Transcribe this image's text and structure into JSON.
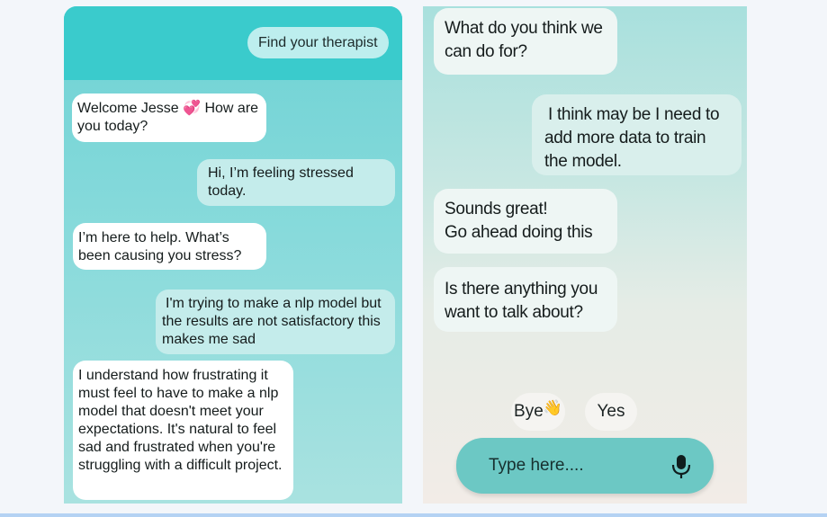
{
  "left_chat": {
    "header_button": "Find your therapist",
    "messages": [
      {
        "sender": "bot",
        "text_before_emoji": "Welcome Jesse",
        "emoji": "💞",
        "text_after_emoji": " How are you today?"
      },
      {
        "sender": "user",
        "text": "Hi, I’m feeling stressed today."
      },
      {
        "sender": "bot",
        "text": "I’m here to help. What’s been causing you stress?"
      },
      {
        "sender": "user",
        "text": "I'm trying to make a nlp model but the results are not satisfactory this makes me sad"
      },
      {
        "sender": "bot",
        "text": "I understand how frustrating it must feel to have to make a nlp model that doesn't meet your expectations. It's natural to feel sad and frustrated when you're struggling with a difficult project."
      }
    ]
  },
  "right_chat": {
    "messages": [
      {
        "sender": "bot",
        "text": "What do you think we can do for?"
      },
      {
        "sender": "user",
        "text": "I think may be I need to add more data to train the model."
      },
      {
        "sender": "bot",
        "line1": "Sounds great!",
        "line2": "Go ahead doing this"
      },
      {
        "sender": "bot",
        "text": "Is there anything you want to talk about?"
      }
    ],
    "quick_replies": [
      {
        "label": "Bye",
        "emoji": "👋"
      },
      {
        "label": "Yes"
      }
    ],
    "input": {
      "placeholder": "Type here....",
      "value": ""
    },
    "icons": {
      "mic": "microphone-icon"
    }
  },
  "colors": {
    "left_header": "#3acbcc",
    "left_background": "#87dadb",
    "input_bar": "#6cc8c4",
    "bot_bubble": "#ffffff",
    "user_bubble": "#c4eceb"
  }
}
